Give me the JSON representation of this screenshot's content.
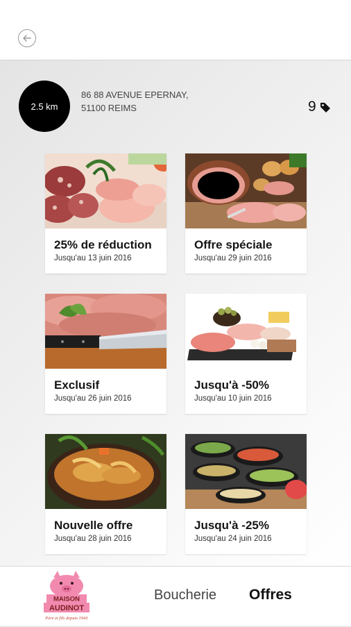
{
  "header": {
    "back_icon": "arrow-left-icon"
  },
  "store": {
    "distance": "2.5 km",
    "address_line1": "86 88 AVENUE EPERNAY,",
    "address_line2": "51100 REIMS",
    "offer_count": "9",
    "count_icon": "tag-icon"
  },
  "offers": [
    {
      "title": "25% de réduction",
      "date": "Jusqu'au 13 juin 2016"
    },
    {
      "title": "Offre spéciale",
      "date": "Jusqu'au 29 juin 2016"
    },
    {
      "title": "Exclusif",
      "date": "Jusqu'au 26 juin 2016"
    },
    {
      "title": "Jusqu'à -50%",
      "date": "Jusqu'au 10 juin 2016"
    },
    {
      "title": "Nouvelle offre",
      "date": "Jusqu'au 28 juin 2016"
    },
    {
      "title": "Jusqu'à -25%",
      "date": "Jusqu'au 24 juin 2016"
    }
  ],
  "bottom_nav": {
    "logo_name": "MAISON AUDINOT",
    "logo_tagline": "Père et fils depuis 1943",
    "tab_boucherie": "Boucherie",
    "tab_offres": "Offres"
  },
  "colors": {
    "accent_pink": "#f28ab0",
    "logo_red": "#c0392b"
  }
}
